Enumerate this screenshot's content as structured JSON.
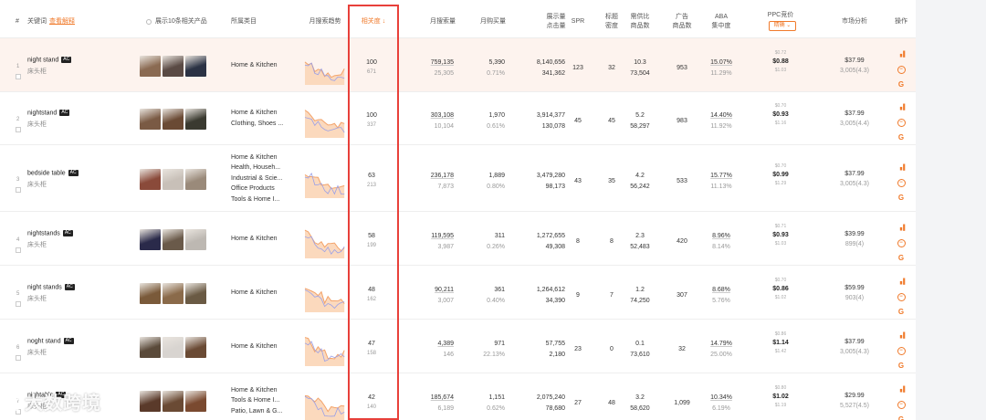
{
  "header": {
    "idx": "#",
    "keyword": "关键词",
    "keyword_link": "查看解释",
    "show_products": "展示10条相关产品",
    "category": "所属类目",
    "trend": "月搜索趋势",
    "relevance": "相关度 ↓",
    "monthly_search": "月搜索量",
    "monthly_buys": "月购买量",
    "display_click_1": "展示量",
    "display_click_2": "点击量",
    "spr": "SPR",
    "title_density_1": "标题",
    "title_density_2": "密度",
    "supply_demand_1": "需供比",
    "supply_demand_2": "商品数",
    "ad_products_1": "广告",
    "ad_products_2": "商品数",
    "aba_1": "ABA",
    "aba_2": "集中度",
    "ppc": "PPC竞价",
    "ppc_select": "精确 ⌄",
    "market": "市场分析",
    "ops": "操作"
  },
  "rows": [
    {
      "idx": "1",
      "keyword": "night stand",
      "badge": "AC",
      "cn": "床头柜",
      "categories": [
        "Home & Kitchen"
      ],
      "rel": "100",
      "rel_sub": "671",
      "search": "759,135",
      "search_sub": "25,305",
      "buys": "5,390",
      "buys_pct": "0.71%",
      "display": "8,140,656",
      "clicks": "341,362",
      "spr": "123",
      "title_density": "32",
      "sd_ratio": "10.3",
      "sd_products": "73,504",
      "ad_products": "953",
      "aba": "15.07%",
      "aba_sub": "11.29%",
      "ppc_hi": "$0.72",
      "ppc_mid": "$0.88",
      "ppc_lo": "$1.03",
      "price": "$37.99",
      "rating": "3,005(4.3)",
      "thumb_colors": [
        "#8a6a52",
        "#5a4a44",
        "#2b3244"
      ]
    },
    {
      "idx": "2",
      "keyword": "nightstand",
      "badge": "AC",
      "cn": "床头柜",
      "categories": [
        "Home & Kitchen",
        "Clothing, Shoes ..."
      ],
      "rel": "100",
      "rel_sub": "337",
      "search": "303,108",
      "search_sub": "10,104",
      "buys": "1,970",
      "buys_pct": "0.61%",
      "display": "3,914,377",
      "clicks": "130,078",
      "spr": "45",
      "title_density": "45",
      "sd_ratio": "5.2",
      "sd_products": "58,297",
      "ad_products": "983",
      "aba": "14.40%",
      "aba_sub": "11.92%",
      "ppc_hi": "$0.70",
      "ppc_mid": "$0.93",
      "ppc_lo": "$1.16",
      "price": "$37.99",
      "rating": "3,005(4.4)",
      "thumb_colors": [
        "#7a5a44",
        "#6a4a34",
        "#3a3a30"
      ]
    },
    {
      "idx": "3",
      "keyword": "bedside table",
      "badge": "AC",
      "cn": "床头柜",
      "categories": [
        "Home & Kitchen",
        "Health, Househ...",
        "Industrial & Scie...",
        "Office Products",
        "Tools & Home I..."
      ],
      "rel": "63",
      "rel_sub": "213",
      "search": "236,178",
      "search_sub": "7,873",
      "buys": "1,889",
      "buys_pct": "0.80%",
      "display": "3,479,280",
      "clicks": "98,173",
      "spr": "43",
      "title_density": "35",
      "sd_ratio": "4.2",
      "sd_products": "56,242",
      "ad_products": "533",
      "aba": "15.77%",
      "aba_sub": "11.13%",
      "ppc_hi": "$0.70",
      "ppc_mid": "$0.99",
      "ppc_lo": "$1.29",
      "price": "$37.99",
      "rating": "3,005(4.3)",
      "thumb_colors": [
        "#8a4a3a",
        "#c8c0b8",
        "#9a8a7a"
      ]
    },
    {
      "idx": "4",
      "keyword": "nightstands",
      "badge": "AC",
      "cn": "床头柜",
      "categories": [
        "Home & Kitchen"
      ],
      "rel": "58",
      "rel_sub": "199",
      "search": "119,595",
      "search_sub": "3,987",
      "buys": "311",
      "buys_pct": "0.26%",
      "display": "1,272,655",
      "clicks": "49,308",
      "spr": "8",
      "title_density": "8",
      "sd_ratio": "2.3",
      "sd_products": "52,483",
      "ad_products": "420",
      "aba": "8.96%",
      "aba_sub": "8.14%",
      "ppc_hi": "$0.71",
      "ppc_mid": "$0.93",
      "ppc_lo": "$1.03",
      "price": "$39.99",
      "rating": "899(4)",
      "thumb_colors": [
        "#2a2a4a",
        "#6a5a4a",
        "#bdb8b2"
      ]
    },
    {
      "idx": "5",
      "keyword": "night stands",
      "badge": "AC",
      "cn": "床头柜",
      "categories": [
        "Home & Kitchen"
      ],
      "rel": "48",
      "rel_sub": "162",
      "search": "90,211",
      "search_sub": "3,007",
      "buys": "361",
      "buys_pct": "0.40%",
      "display": "1,264,612",
      "clicks": "34,390",
      "spr": "9",
      "title_density": "7",
      "sd_ratio": "1.2",
      "sd_products": "74,250",
      "ad_products": "307",
      "aba": "8.68%",
      "aba_sub": "5.76%",
      "ppc_hi": "$0.70",
      "ppc_mid": "$0.86",
      "ppc_lo": "$1.02",
      "price": "$59.99",
      "rating": "903(4)",
      "thumb_colors": [
        "#7a5a3a",
        "#8a6a4a",
        "#6a5a44"
      ]
    },
    {
      "idx": "6",
      "keyword": "noght stand",
      "badge": "AC",
      "cn": "床头柜",
      "categories": [
        "Home & Kitchen"
      ],
      "rel": "47",
      "rel_sub": "158",
      "search": "4,389",
      "search_sub": "146",
      "buys": "971",
      "buys_pct": "22.13%",
      "display": "57,755",
      "clicks": "2,180",
      "spr": "23",
      "title_density": "0",
      "sd_ratio": "0.1",
      "sd_products": "73,610",
      "ad_products": "32",
      "aba": "14.79%",
      "aba_sub": "25.00%",
      "ppc_hi": "$0.86",
      "ppc_mid": "$1.14",
      "ppc_lo": "$1.42",
      "price": "$37.99",
      "rating": "3,005(4.3)",
      "thumb_colors": [
        "#5a4a3a",
        "#d8d4d0",
        "#6a4a34"
      ]
    },
    {
      "idx": "7",
      "keyword": "nightable",
      "badge": "AC",
      "cn": "床头柜",
      "categories": [
        "Home & Kitchen",
        "Tools & Home I...",
        "Patio, Lawn & G..."
      ],
      "rel": "42",
      "rel_sub": "140",
      "search": "185,674",
      "search_sub": "6,189",
      "buys": "1,151",
      "buys_pct": "0.62%",
      "display": "2,075,240",
      "clicks": "78,680",
      "spr": "27",
      "title_density": "48",
      "sd_ratio": "3.2",
      "sd_products": "58,620",
      "ad_products": "1,099",
      "aba": "10.34%",
      "aba_sub": "6.19%",
      "ppc_hi": "$0.80",
      "ppc_mid": "$1.02",
      "ppc_lo": "$1.19",
      "price": "$29.99",
      "rating": "5,527(4.5)",
      "thumb_colors": [
        "#5a3a2a",
        "#6a4a34",
        "#7a4a30"
      ]
    }
  ],
  "action_icons": [
    "bar-chart-icon",
    "minus-circle-icon",
    "google-icon"
  ],
  "watermark": "大数跨境",
  "colors": {
    "accent": "#f07a2b",
    "highlight_border": "#e8403a",
    "row_highlight": "#fdf3ee"
  }
}
